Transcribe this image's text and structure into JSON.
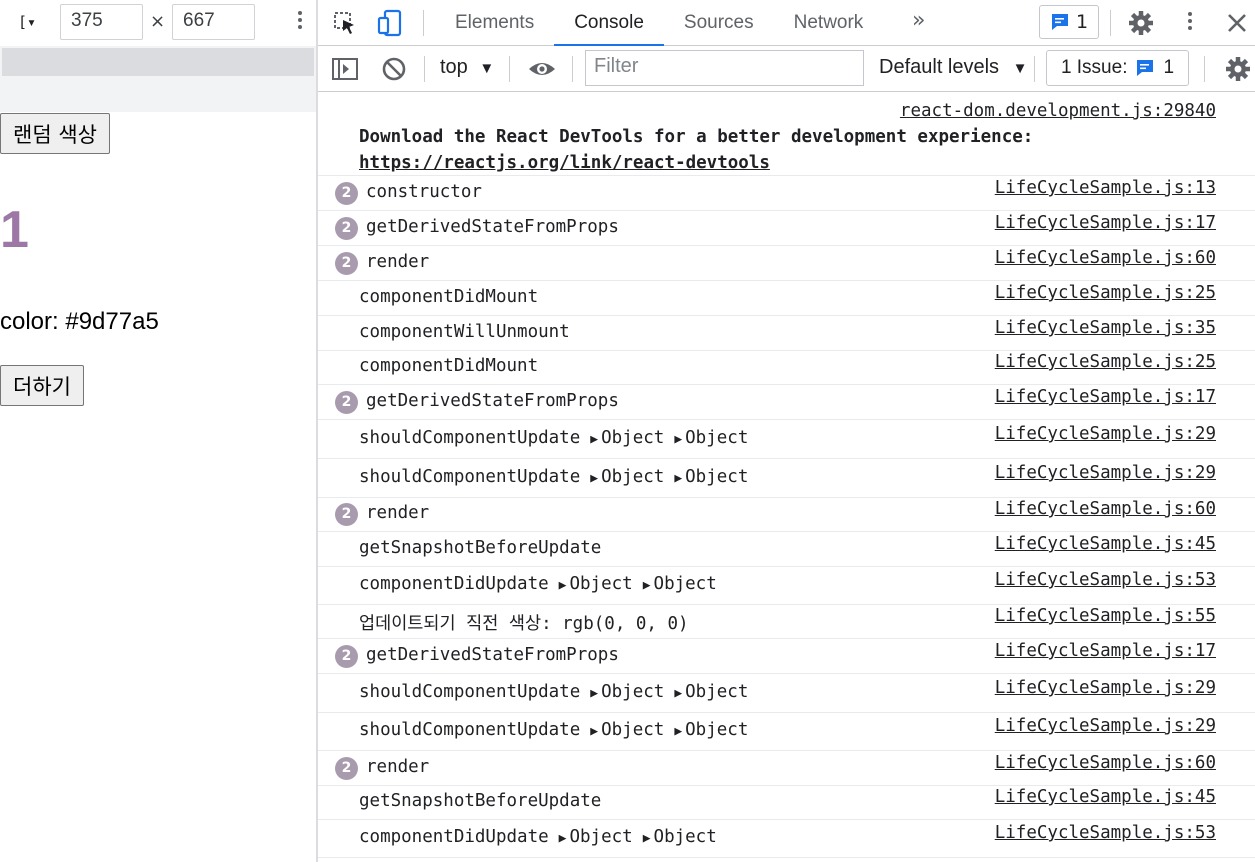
{
  "device_toolbar": {
    "device_icon": "[▾",
    "width": "375",
    "height": "667",
    "times": "×"
  },
  "page": {
    "random_color_button": "랜덤 색상",
    "counter": "1",
    "color_label": "color: #9d77a5",
    "add_button": "더하기",
    "number_color": "#9d77a5"
  },
  "devtools": {
    "tabs": [
      "Elements",
      "Console",
      "Sources",
      "Network"
    ],
    "active_tab": "Console",
    "more_tabs": "»",
    "message_count": "1",
    "context": "top",
    "filter_placeholder": "Filter",
    "levels": "Default levels",
    "issues_label": "1 Issue:",
    "issues_count": "1",
    "accent": "#1a73e8"
  },
  "console": {
    "react_notice": {
      "source": "react-dom.development.js:29840",
      "text": "Download the React DevTools for a better development experience: ",
      "link": "https://reactjs.org/link/react-devtools"
    },
    "entries": [
      {
        "count": "2",
        "text": "constructor",
        "source": "LifeCycleSample.js:13"
      },
      {
        "count": "2",
        "text": "getDerivedStateFromProps",
        "source": "LifeCycleSample.js:17"
      },
      {
        "count": "2",
        "text": "render",
        "source": "LifeCycleSample.js:60"
      },
      {
        "count": "",
        "text": "componentDidMount",
        "source": "LifeCycleSample.js:25"
      },
      {
        "count": "",
        "text": "componentWillUnmount",
        "source": "LifeCycleSample.js:35"
      },
      {
        "count": "",
        "text": "componentDidMount",
        "source": "LifeCycleSample.js:25"
      },
      {
        "count": "2",
        "text": "getDerivedStateFromProps",
        "source": "LifeCycleSample.js:17"
      },
      {
        "count": "",
        "text": "shouldComponentUpdate",
        "objects": [
          "Object",
          "Object"
        ],
        "source": "LifeCycleSample.js:29"
      },
      {
        "count": "",
        "text": "shouldComponentUpdate",
        "objects": [
          "Object",
          "Object"
        ],
        "source": "LifeCycleSample.js:29"
      },
      {
        "count": "2",
        "text": "render",
        "source": "LifeCycleSample.js:60"
      },
      {
        "count": "",
        "text": "getSnapshotBeforeUpdate",
        "source": "LifeCycleSample.js:45"
      },
      {
        "count": "",
        "text": "componentDidUpdate",
        "objects": [
          "Object",
          "Object"
        ],
        "source": "LifeCycleSample.js:53"
      },
      {
        "count": "",
        "text": "업데이트되기 직전 색상:  rgb(0, 0, 0)",
        "source": "LifeCycleSample.js:55"
      },
      {
        "count": "2",
        "text": "getDerivedStateFromProps",
        "source": "LifeCycleSample.js:17"
      },
      {
        "count": "",
        "text": "shouldComponentUpdate",
        "objects": [
          "Object",
          "Object"
        ],
        "source": "LifeCycleSample.js:29"
      },
      {
        "count": "",
        "text": "shouldComponentUpdate",
        "objects": [
          "Object",
          "Object"
        ],
        "source": "LifeCycleSample.js:29"
      },
      {
        "count": "2",
        "text": "render",
        "source": "LifeCycleSample.js:60"
      },
      {
        "count": "",
        "text": "getSnapshotBeforeUpdate",
        "source": "LifeCycleSample.js:45"
      },
      {
        "count": "",
        "text": "componentDidUpdate",
        "objects": [
          "Object",
          "Object"
        ],
        "source": "LifeCycleSample.js:53"
      }
    ]
  }
}
